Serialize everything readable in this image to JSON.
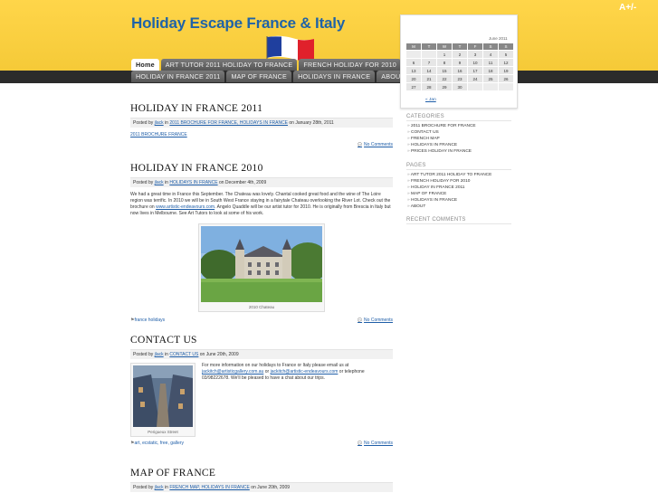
{
  "header": {
    "site_title": "Holiday Escape France & Italy",
    "font_toggle": "A+/-"
  },
  "nav": {
    "row1": [
      "Home",
      "ART TUTOR 2011 HOLIDAY TO FRANCE",
      "FRENCH HOLIDAY FOR 2010"
    ],
    "row2": [
      "HOLIDAY IN FRANCE 2011",
      "MAP OF FRANCE",
      "HOLIDAYS IN FRANCE",
      "ABOUT"
    ]
  },
  "posts": [
    {
      "title": "HOLIDAY IN FRANCE 2011",
      "meta_prefix": "Posted by",
      "author": "jlack",
      "meta_in": "in",
      "categories": "2011 BROCHURE FOR FRANCE, HOLIDAYS IN FRANCE",
      "meta_date": "on January 28th, 2011",
      "body_link": "2011 BROCHURE FRANCE",
      "comments": "No Comments"
    },
    {
      "title": "HOLIDAY IN FRANCE 2010",
      "meta_prefix": "Posted by",
      "author": "jlack",
      "meta_in": "in",
      "categories": "HOLIDAYS IN FRANCE",
      "meta_date": "on December 4th, 2009",
      "body_a": "We had a great time in France this September.  The Chateau was lovely.  Chantal cooked  great food and the wine of  The Loire region was terrific.   In 2010 we will be in South West France staying in a fairytale Chateau overlooking the River Lot.   Check out the brochure on",
      "body_link": "www.artistic-endeavours.com",
      "body_b": ".  Angelo Quaddle will be our artist tutor for 2010.   He is originally from Brescia in Italy but now lives in Melbourne.   See Art Tutors to look at some of his work.",
      "photo_caption": "2010 Chateau",
      "tags": "france holidays",
      "comments": "No Comments"
    },
    {
      "title": "CONTACT US",
      "meta_prefix": "Posted by",
      "author": "jlack",
      "meta_in": "in",
      "categories": "CONTACT US",
      "meta_date": "on June 20th, 2009",
      "body_a": "For more information on our holidays to France or Italy please email us at",
      "email1": "jackitch@artisticgallery.com.au",
      "body_or": "or",
      "email2": "jackitch@artistic-endeavours.com",
      "body_b": "or telephone 03/98222678.  We'll be pleased to have a chat about our trips.",
      "photo_caption": "Perigueux Street",
      "tags": "art, ecstatic, free, gallery",
      "comments": "No Comments"
    },
    {
      "title": "MAP OF FRANCE",
      "meta_prefix": "Posted by",
      "author": "jlack",
      "meta_in": "in",
      "categories": "FRENCH MAP, HOLIDAYS IN FRANCE",
      "meta_date": "on June 20th, 2009"
    }
  ],
  "calendar": {
    "caption": "June 2011",
    "weekdays": [
      "M",
      "T",
      "W",
      "T",
      "F",
      "S",
      "S"
    ],
    "weeks": [
      [
        "",
        "",
        "1",
        "2",
        "3",
        "4",
        "5"
      ],
      [
        "6",
        "7",
        "8",
        "9",
        "10",
        "11",
        "12"
      ],
      [
        "13",
        "14",
        "15",
        "16",
        "17",
        "18",
        "19"
      ],
      [
        "20",
        "21",
        "22",
        "23",
        "24",
        "25",
        "26"
      ],
      [
        "27",
        "28",
        "29",
        "30",
        "",
        "",
        ""
      ]
    ],
    "prev_link": "« Jan"
  },
  "sidebar": {
    "categories_title": "CATEGORIES",
    "categories": [
      "2011 BROCHURE FOR FRANCE",
      "CONTACT US",
      "FRENCH MAP",
      "HOLIDAYS IN FRANCE",
      "PRICES HOLIDAY IN FRANCE"
    ],
    "pages_title": "PAGES",
    "pages": [
      "ART TUTOR 2011 HOLIDAY TO FRANCE",
      "FRENCH HOLIDAY FOR 2010",
      "HOLIDAY IN FRANCE 2011",
      "MAP OF FRANCE",
      "HOLIDAYS IN FRANCE",
      "ABOUT"
    ],
    "recent_comments_title": "RECENT COMMENTS"
  },
  "colors": {
    "header_yellow": "#ffd23a",
    "title_blue": "#1f63a8",
    "nav_dark": "#2b2b2b"
  }
}
